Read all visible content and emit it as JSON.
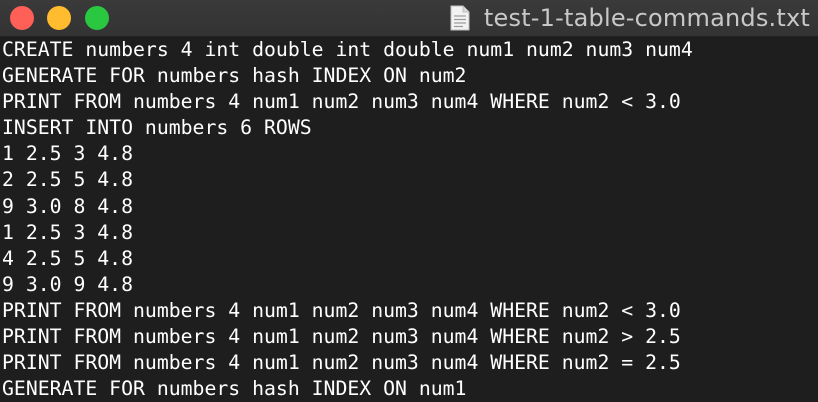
{
  "window": {
    "title": "test-1-table-commands.txt",
    "file_icon": "document-icon"
  },
  "colors": {
    "background": "#1e1e1e",
    "text": "#ffffff",
    "close": "#fe5f57",
    "minimize": "#febc2e",
    "zoom": "#29c840"
  },
  "lines": [
    "CREATE numbers 4 int double int double num1 num2 num3 num4",
    "GENERATE FOR numbers hash INDEX ON num2",
    "PRINT FROM numbers 4 num1 num2 num3 num4 WHERE num2 < 3.0",
    "INSERT INTO numbers 6 ROWS",
    "1 2.5 3 4.8",
    "2 2.5 5 4.8",
    "9 3.0 8 4.8",
    "1 2.5 3 4.8",
    "4 2.5 5 4.8",
    "9 3.0 9 4.8",
    "PRINT FROM numbers 4 num1 num2 num3 num4 WHERE num2 < 3.0",
    "PRINT FROM numbers 4 num1 num2 num3 num4 WHERE num2 > 2.5",
    "PRINT FROM numbers 4 num1 num2 num3 num4 WHERE num2 = 2.5",
    "GENERATE FOR numbers hash INDEX ON num1"
  ]
}
